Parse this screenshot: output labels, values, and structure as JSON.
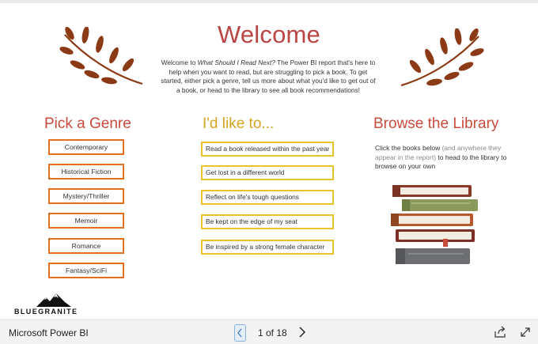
{
  "welcome": {
    "title": "Welcome",
    "intro_pre": "Welcome to ",
    "intro_em": "What Should I Read Next?",
    "intro_post": " The Power BI report that's here to help when you want to read, but are struggling to pick a book. To get started, either pick a genre, tell us more about what you'd like to get out of a book, or head to the library to see all book recommendations!"
  },
  "genre": {
    "heading": "Pick a Genre",
    "items": [
      "Contemporary",
      "Historical Fiction",
      "Mystery/Thriller",
      "Memoir",
      "Romance",
      "Fantasy/SciFi"
    ]
  },
  "like": {
    "heading": "I'd like to...",
    "items": [
      "Read a book released within the past year",
      "Get lost in a different world",
      "Reflect on life's tough questions",
      "Be kept on the edge of my seat",
      "Be inspired by a strong female character"
    ]
  },
  "browse": {
    "heading": "Browse the Library",
    "desc_a": "Click the books below ",
    "desc_b": "(and anywhere they appear in the report)",
    "desc_c": " to head to the library to browse on your own"
  },
  "brand": {
    "name": "BLUEGRANITE"
  },
  "footer": {
    "app_title": "Microsoft Power BI",
    "page_label": "1 of  18"
  },
  "icons": {
    "laurel": "laurel-branch-icon",
    "books": "book-stack-icon",
    "prev": "chevron-left-icon",
    "next": "chevron-right-icon",
    "share": "share-icon",
    "expand": "expand-icon"
  },
  "colors": {
    "welcome": "#b94545",
    "genre_border": "#e0701e",
    "like_border": "#e8c32c",
    "leaf": "#8b3a15"
  }
}
